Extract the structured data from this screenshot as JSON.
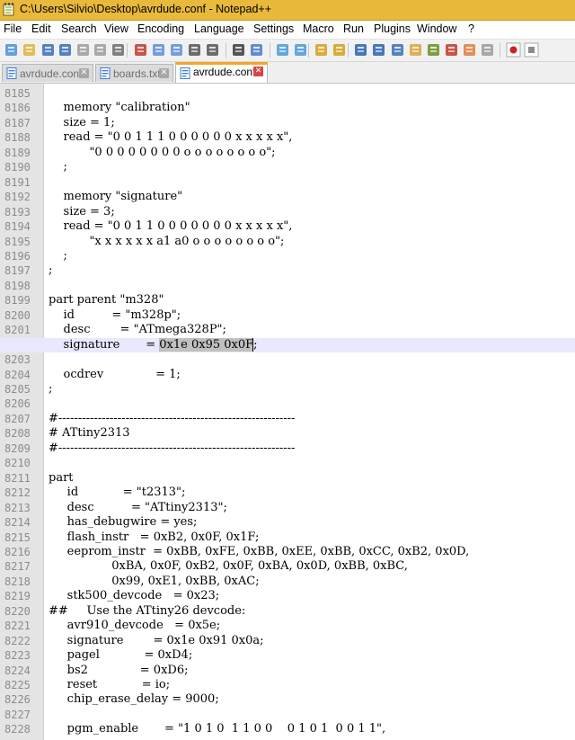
{
  "window": {
    "title": "C:\\Users\\Silvio\\Desktop\\avrdude.conf - Notepad++"
  },
  "menu": [
    "File",
    "Edit",
    "Search",
    "View",
    "Encoding",
    "Language",
    "Settings",
    "Macro",
    "Run",
    "Plugins",
    "Window",
    "?"
  ],
  "toolbar": {
    "icons": [
      "new-file-icon",
      "open-file-icon",
      "save-icon",
      "save-all-icon",
      "close-icon",
      "close-all-icon",
      "print-icon",
      "cut-icon",
      "copy-icon",
      "paste-icon",
      "undo-icon",
      "redo-icon",
      "find-icon",
      "replace-icon",
      "zoom-in-icon",
      "zoom-out-icon",
      "sync-vertical-icon",
      "sync-horizontal-icon",
      "word-wrap-icon",
      "show-all-chars-icon",
      "indent-guide-icon",
      "user-language-icon",
      "document-map-icon",
      "function-list-icon",
      "folder-workspace-icon",
      "monitoring-icon",
      "record-macro-icon",
      "stop-macro-icon"
    ]
  },
  "tabs": [
    {
      "label": "avrdude.conf",
      "active": false,
      "color": "#3a7bd5"
    },
    {
      "label": "boards.txt",
      "active": false,
      "color": "#3a7bd5"
    },
    {
      "label": "avrdude.conf",
      "active": true,
      "color": "#3a7bd5"
    }
  ],
  "editor": {
    "current_line": "8202",
    "lines": [
      {
        "n": "8185",
        "text": ""
      },
      {
        "n": "8186",
        "text": "    memory \"calibration\""
      },
      {
        "n": "8187",
        "text": "    size = 1;"
      },
      {
        "n": "8188",
        "text": "    read = \"0 0 1 1 1 0 0 0 0 0 0 x x x x x\","
      },
      {
        "n": "8189",
        "text": "           \"0 0 0 0 0 0 0 0 o o o o o o o o\";"
      },
      {
        "n": "8190",
        "text": "    ;"
      },
      {
        "n": "8191",
        "text": ""
      },
      {
        "n": "8192",
        "text": "    memory \"signature\""
      },
      {
        "n": "8193",
        "text": "    size = 3;"
      },
      {
        "n": "8194",
        "text": "    read = \"0 0 1 1 0 0 0 0 0 0 0 x x x x x\","
      },
      {
        "n": "8195",
        "text": "           \"x x x x x x a1 a0 o o o o o o o o\";"
      },
      {
        "n": "8196",
        "text": "    ;"
      },
      {
        "n": "8197",
        "text": ";"
      },
      {
        "n": "8198",
        "text": ""
      },
      {
        "n": "8199",
        "text": "part parent \"m328\""
      },
      {
        "n": "8200",
        "text": "    id          = \"m328p\";"
      },
      {
        "n": "8201",
        "text": "    desc        = \"ATmega328P\";"
      },
      {
        "n": "8202",
        "pre": "    signature       = ",
        "sel": "0x1e 0x95 0x0F",
        "post": ";"
      },
      {
        "n": "8203",
        "text": ""
      },
      {
        "n": "8204",
        "text": "    ocdrev              = 1;"
      },
      {
        "n": "8205",
        "text": ";"
      },
      {
        "n": "8206",
        "text": ""
      },
      {
        "n": "8207",
        "text": "#------------------------------------------------------------"
      },
      {
        "n": "8208",
        "text": "# ATtiny2313"
      },
      {
        "n": "8209",
        "text": "#------------------------------------------------------------"
      },
      {
        "n": "8210",
        "text": ""
      },
      {
        "n": "8211",
        "text": "part"
      },
      {
        "n": "8212",
        "text": "     id            = \"t2313\";"
      },
      {
        "n": "8213",
        "text": "     desc          = \"ATtiny2313\";"
      },
      {
        "n": "8214",
        "text": "     has_debugwire = yes;"
      },
      {
        "n": "8215",
        "text": "     flash_instr   = 0xB2, 0x0F, 0x1F;"
      },
      {
        "n": "8216",
        "text": "     eeprom_instr  = 0xBB, 0xFE, 0xBB, 0xEE, 0xBB, 0xCC, 0xB2, 0x0D,"
      },
      {
        "n": "8217",
        "text": "                 0xBA, 0x0F, 0xB2, 0x0F, 0xBA, 0x0D, 0xBB, 0xBC,"
      },
      {
        "n": "8218",
        "text": "                 0x99, 0xE1, 0xBB, 0xAC;"
      },
      {
        "n": "8219",
        "text": "     stk500_devcode   = 0x23;"
      },
      {
        "n": "8220",
        "text": "##     Use the ATtiny26 devcode:"
      },
      {
        "n": "8221",
        "text": "     avr910_devcode   = 0x5e;"
      },
      {
        "n": "8222",
        "text": "     signature        = 0x1e 0x91 0x0a;"
      },
      {
        "n": "8223",
        "text": "     pagel            = 0xD4;"
      },
      {
        "n": "8224",
        "text": "     bs2              = 0xD6;"
      },
      {
        "n": "8225",
        "text": "     reset            = io;"
      },
      {
        "n": "8226",
        "text": "     chip_erase_delay = 9000;"
      },
      {
        "n": "8227",
        "text": ""
      },
      {
        "n": "8228",
        "text": "     pgm_enable       = \"1 0 1 0  1 1 0 0    0 1 0 1  0 0 1 1\","
      }
    ]
  }
}
